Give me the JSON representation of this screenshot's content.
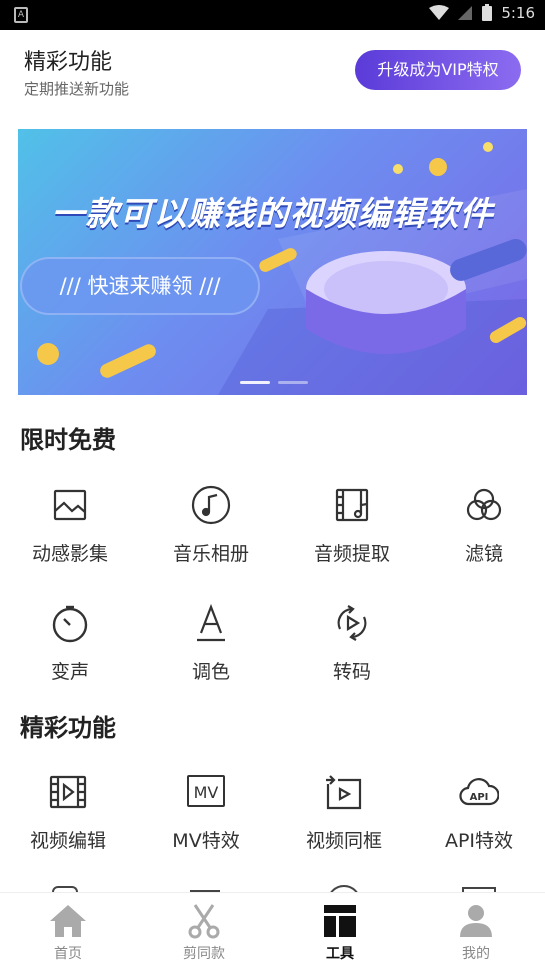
{
  "status_bar": {
    "time": "5:16"
  },
  "header": {
    "title": "精彩功能",
    "subtitle": "定期推送新功能",
    "vip_button": "升级成为VIP特权"
  },
  "banner": {
    "headline": "一款可以赚钱的视频编辑软件",
    "pill": "/// 快速来赚领 ///",
    "page_indicator": {
      "count": 2,
      "active": 0
    }
  },
  "sections": {
    "free": {
      "title": "限时免费",
      "items": [
        {
          "label": "动感影集",
          "icon": "photo-album-icon"
        },
        {
          "label": "音乐相册",
          "icon": "music-note-icon"
        },
        {
          "label": "音频提取",
          "icon": "audio-extract-icon"
        },
        {
          "label": "滤镜",
          "icon": "filter-icon"
        },
        {
          "label": "变声",
          "icon": "voice-change-icon"
        },
        {
          "label": "调色",
          "icon": "color-adjust-icon"
        },
        {
          "label": "转码",
          "icon": "transcode-icon"
        }
      ]
    },
    "featured": {
      "title": "精彩功能",
      "items": [
        {
          "label": "视频编辑",
          "icon": "video-edit-icon"
        },
        {
          "label": "MV特效",
          "icon": "mv-icon"
        },
        {
          "label": "视频同框",
          "icon": "video-duet-icon"
        },
        {
          "label": "API特效",
          "icon": "api-cloud-icon"
        }
      ]
    }
  },
  "tabbar": {
    "tabs": [
      {
        "label": "首页",
        "icon": "home-icon"
      },
      {
        "label": "剪同款",
        "icon": "scissors-icon"
      },
      {
        "label": "工具",
        "icon": "tools-grid-icon",
        "active": true
      },
      {
        "label": "我的",
        "icon": "user-icon"
      }
    ]
  },
  "colors": {
    "accent": "#6a4ce0",
    "text": "#222222",
    "tab_inactive": "#888888"
  }
}
